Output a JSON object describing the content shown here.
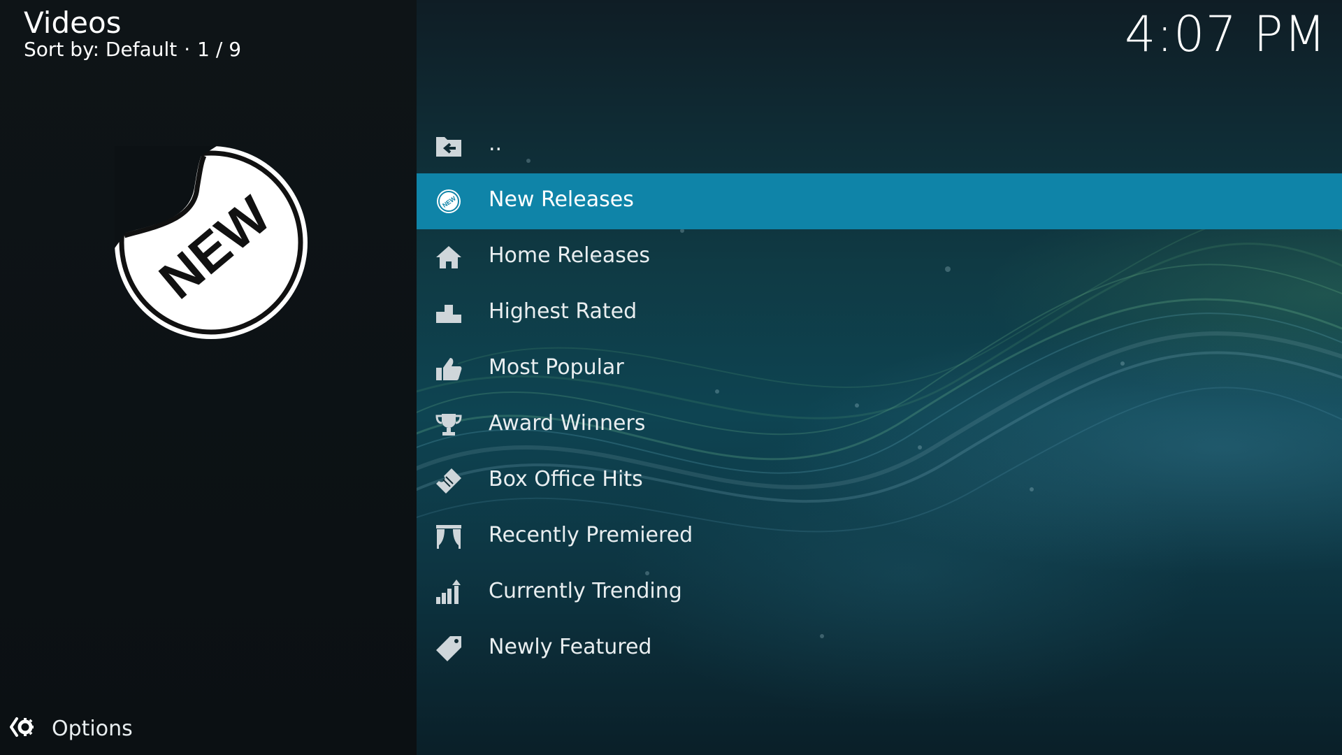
{
  "header": {
    "title": "Videos",
    "sort_label": "Sort by: Default",
    "separator": "·",
    "position": "1 / 9"
  },
  "clock": "4:07 PM",
  "thumbnail": {
    "icon": "new-sticker-icon",
    "text": "NEW"
  },
  "list": {
    "selected_index": 1,
    "items": [
      {
        "label": "..",
        "icon": "folder-back-icon"
      },
      {
        "label": "New Releases",
        "icon": "new-badge-icon"
      },
      {
        "label": "Home Releases",
        "icon": "home-icon"
      },
      {
        "label": "Highest Rated",
        "icon": "podium-icon"
      },
      {
        "label": "Most Popular",
        "icon": "thumbs-up-icon"
      },
      {
        "label": "Award Winners",
        "icon": "trophy-icon"
      },
      {
        "label": "Box Office Hits",
        "icon": "ticket-icon"
      },
      {
        "label": "Recently Premiered",
        "icon": "theater-curtain-icon"
      },
      {
        "label": "Currently Trending",
        "icon": "trending-bars-icon"
      },
      {
        "label": "Newly Featured",
        "icon": "tag-icon"
      }
    ]
  },
  "footer": {
    "options_label": "Options",
    "icon": "options-gear-icon"
  },
  "colors": {
    "accent": "#0f84a8",
    "background": "#0b1216"
  }
}
